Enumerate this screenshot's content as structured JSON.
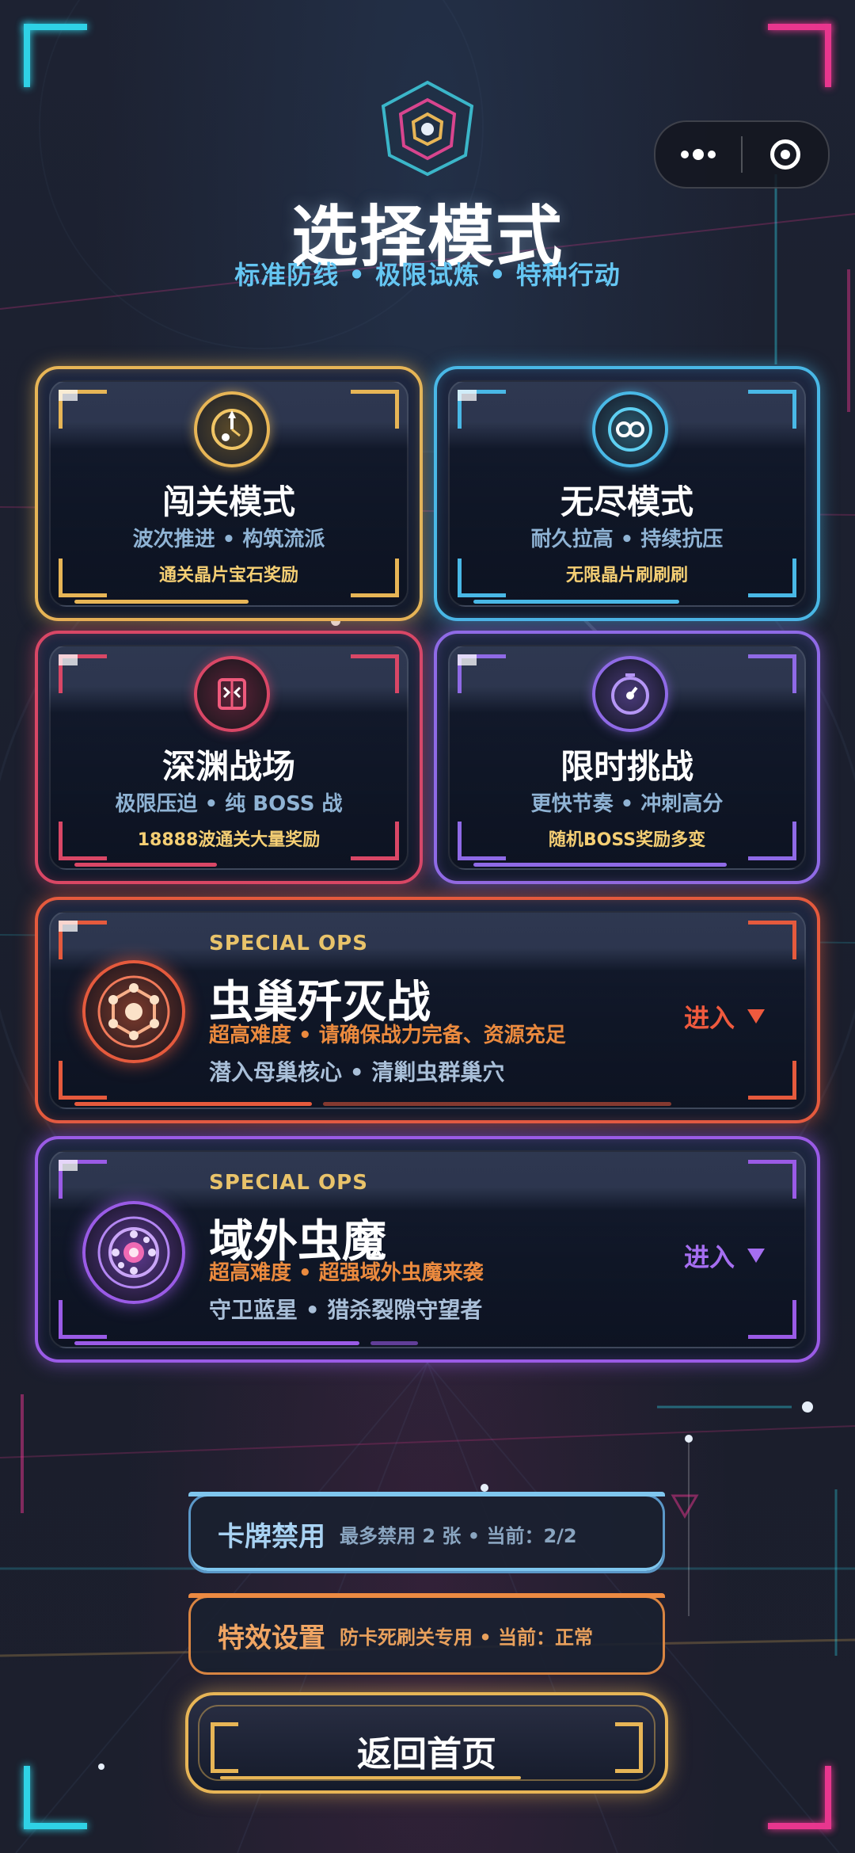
{
  "header": {
    "title": "选择模式",
    "subtitle": "标准防线 • 极限试炼 • 特种行动"
  },
  "capsule": {
    "more": "more-icon",
    "close": "target-icon"
  },
  "modes": [
    {
      "title": "闯关模式",
      "sub": "波次推进 • 构筑流派",
      "reward": "通关晶片宝石奖励",
      "color": "#e7b556",
      "icon": "hourglass-icon"
    },
    {
      "title": "无尽模式",
      "sub": "耐久拉高 • 持续抗压",
      "reward": "无限晶片刷刷刷",
      "color": "#49b8e6",
      "icon": "infinity-icon"
    },
    {
      "title": "深渊战场",
      "sub": "极限压迫 • 纯 BOSS 战",
      "reward": "18888波通关大量奖励",
      "color": "#d94766",
      "icon": "abyss-gate-icon"
    },
    {
      "title": "限时挑战",
      "sub": "更快节奏 • 冲刺高分",
      "reward": "随机BOSS奖励多变",
      "color": "#8f6ae6",
      "icon": "timer-icon"
    }
  ],
  "special_ops": [
    {
      "tag": "SPECIAL OPS",
      "title": "虫巢歼灭战",
      "desc1": "超高难度 • 请确保战力完备、资源充足",
      "desc2": "潜入母巢核心 • 清剿虫群巢穴",
      "enter": "进入",
      "color": "#e55a3d",
      "icon": "hive-icon"
    },
    {
      "tag": "SPECIAL OPS",
      "title": "域外虫魔",
      "desc1": "超高难度 • 超强域外虫魔来袭",
      "desc2": "守卫蓝星 • 猎杀裂隙守望者",
      "enter": "进入",
      "color": "#9a5be6",
      "icon": "rift-core-icon"
    }
  ],
  "settings": {
    "ban": {
      "title": "卡牌禁用",
      "info": "最多禁用 2 张 • 当前：2/2"
    },
    "fx": {
      "title": "特效设置",
      "info": "防卡死刷关专用 • 当前：正常"
    }
  },
  "home_button": "返回首页"
}
